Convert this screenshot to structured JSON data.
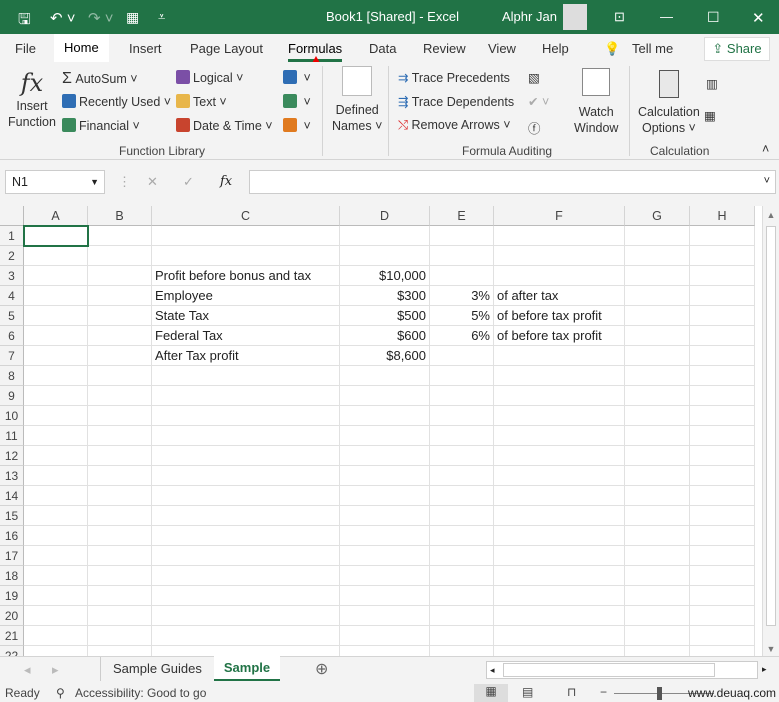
{
  "title_bar": {
    "doc_title": "Book1  [Shared]  -  Excel",
    "user": "Alphr Jan",
    "brand_color": "#217346"
  },
  "tabs": [
    "File",
    "Home",
    "Insert",
    "Page Layout",
    "Formulas",
    "Data",
    "Review",
    "View",
    "Help"
  ],
  "tell_me": "Tell me",
  "share": "Share",
  "active_tab": "Formulas",
  "ribbon": {
    "insert_function": [
      "Insert",
      "Function"
    ],
    "autosum": "AutoSum",
    "recently_used": "Recently Used",
    "financial": "Financial",
    "logical": "Logical",
    "text": "Text",
    "date_time": "Date & Time",
    "defined_names": [
      "Defined",
      "Names"
    ],
    "trace_precedents": "Trace Precedents",
    "trace_dependents": "Trace Dependents",
    "remove_arrows": "Remove Arrows",
    "watch_window": [
      "Watch",
      "Window"
    ],
    "calculation_options": [
      "Calculation",
      "Options"
    ],
    "groups": [
      "Function Library",
      "Formula Auditing",
      "Calculation"
    ]
  },
  "formula_bar": {
    "name_box": "N1",
    "fx": "fx",
    "value": ""
  },
  "columns": [
    "A",
    "B",
    "C",
    "D",
    "E",
    "F",
    "G",
    "H"
  ],
  "rows": [
    "1",
    "2",
    "3",
    "4",
    "5",
    "6",
    "7",
    "8",
    "9",
    "10",
    "11",
    "12",
    "13",
    "14",
    "15",
    "16",
    "17",
    "18",
    "19",
    "20",
    "21",
    "22"
  ],
  "cells": [
    {
      "row": 3,
      "col": "C",
      "value": "Profit before bonus and tax"
    },
    {
      "row": 3,
      "col": "D",
      "value": "$10,000"
    },
    {
      "row": 4,
      "col": "C",
      "value": "Employee"
    },
    {
      "row": 4,
      "col": "D",
      "value": "$300"
    },
    {
      "row": 4,
      "col": "E",
      "value": "3%"
    },
    {
      "row": 4,
      "col": "F",
      "value": "of after tax"
    },
    {
      "row": 5,
      "col": "C",
      "value": "State Tax"
    },
    {
      "row": 5,
      "col": "D",
      "value": "$500"
    },
    {
      "row": 5,
      "col": "E",
      "value": "5%"
    },
    {
      "row": 5,
      "col": "F",
      "value": "of before tax profit"
    },
    {
      "row": 6,
      "col": "C",
      "value": "Federal Tax"
    },
    {
      "row": 6,
      "col": "D",
      "value": "$600"
    },
    {
      "row": 6,
      "col": "E",
      "value": "6%"
    },
    {
      "row": 6,
      "col": "F",
      "value": "of before tax profit"
    },
    {
      "row": 7,
      "col": "C",
      "value": "After Tax profit"
    },
    {
      "row": 7,
      "col": "D",
      "value": "$8,600"
    }
  ],
  "sheets": [
    "Sample Guides",
    "Sample"
  ],
  "active_sheet": "Sample",
  "status": {
    "ready": "Ready",
    "accessibility": "Accessibility: Good to go",
    "watermark": "www.deuaq.com"
  }
}
